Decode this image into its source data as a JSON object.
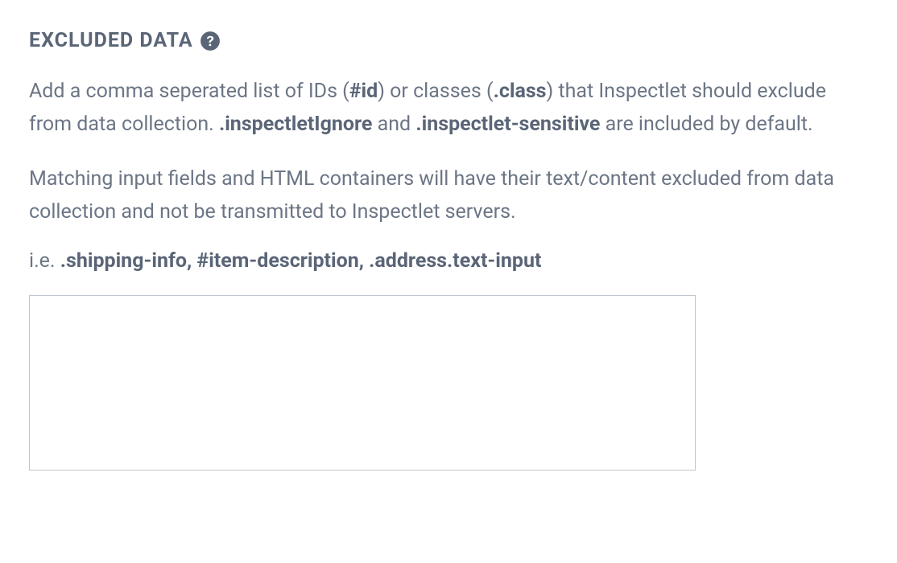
{
  "section": {
    "title": "EXCLUDED DATA",
    "helpIconName": "help-icon"
  },
  "paragraph1": {
    "part1": "Add a comma seperated list of IDs (",
    "bold1": "#id",
    "part2": ") or classes (",
    "bold2": ".class",
    "part3": ") that Inspectlet should exclude from data collection. ",
    "bold3": ".inspectletIgnore",
    "part4": " and ",
    "bold4": ".inspectlet-sensitive",
    "part5": " are included by default."
  },
  "paragraph2": "Matching input fields and HTML containers will have their text/content excluded from data collection and not be transmitted to Inspectlet servers.",
  "example": {
    "prefix": "i.e. ",
    "bold": ".shipping-info, #item-description, .address.text-input"
  },
  "textarea": {
    "value": "",
    "placeholder": ""
  }
}
